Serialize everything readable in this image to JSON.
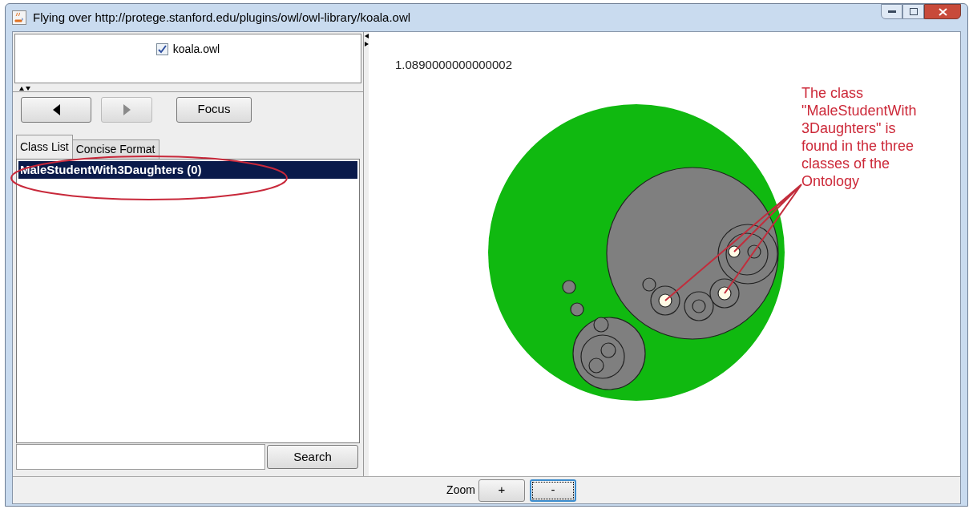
{
  "window": {
    "title": "Flying over http://protege.stanford.edu/plugins/owl/owl-library/koala.owl"
  },
  "ontologies": [
    {
      "label": "koala.owl",
      "checked": true
    }
  ],
  "nav_buttons": [
    {
      "kind": "back",
      "disabled": false
    },
    {
      "kind": "forward",
      "disabled": true
    },
    {
      "kind": "text",
      "label": "Focus",
      "disabled": false
    }
  ],
  "tabs": [
    {
      "label": "Class List",
      "selected": true
    },
    {
      "label": "Concise Format",
      "selected": false
    }
  ],
  "class_list": [
    {
      "label": "MaleStudentWith3Daughters (0)",
      "selected": true
    }
  ],
  "search": {
    "button": "Search"
  },
  "canvas": {
    "scale": "1.0890000000000002",
    "annotation": "The class\n\"MaleStudentWith\n3Daughters\" is\nfound in the three\nclasses of the\nOntology"
  },
  "zoom": {
    "label": "Zoom",
    "buttons": [
      {
        "label": "+",
        "focused": false
      },
      {
        "label": "-",
        "focused": true
      }
    ]
  }
}
